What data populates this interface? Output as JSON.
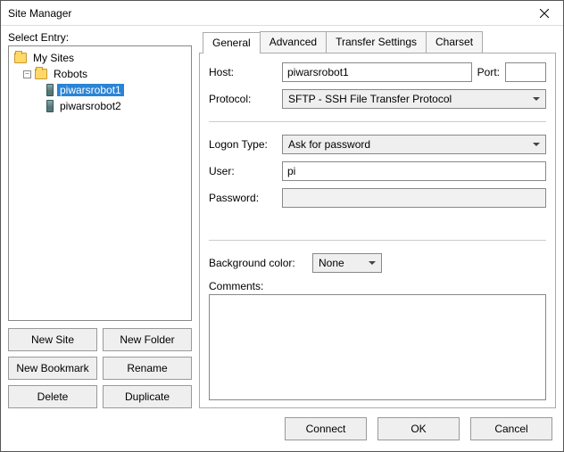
{
  "window": {
    "title": "Site Manager"
  },
  "left": {
    "label": "Select Entry:",
    "tree": {
      "root": "My Sites",
      "folder": "Robots",
      "items": [
        "piwarsrobot1",
        "piwarsrobot2"
      ],
      "selected_index": 0
    },
    "buttons": {
      "new_site": "New Site",
      "new_folder": "New Folder",
      "new_bookmark": "New Bookmark",
      "rename": "Rename",
      "delete": "Delete",
      "duplicate": "Duplicate"
    }
  },
  "tabs": {
    "general": "General",
    "advanced": "Advanced",
    "transfer": "Transfer Settings",
    "charset": "Charset"
  },
  "general": {
    "host_label": "Host:",
    "host_value": "piwarsrobot1",
    "port_label": "Port:",
    "port_value": "",
    "protocol_label": "Protocol:",
    "protocol_value": "SFTP - SSH File Transfer Protocol",
    "logon_type_label": "Logon Type:",
    "logon_type_value": "Ask for password",
    "user_label": "User:",
    "user_value": "pi",
    "password_label": "Password:",
    "password_value": "",
    "bgcolor_label": "Background color:",
    "bgcolor_value": "None",
    "comments_label": "Comments:",
    "comments_value": ""
  },
  "footer": {
    "connect": "Connect",
    "ok": "OK",
    "cancel": "Cancel"
  }
}
